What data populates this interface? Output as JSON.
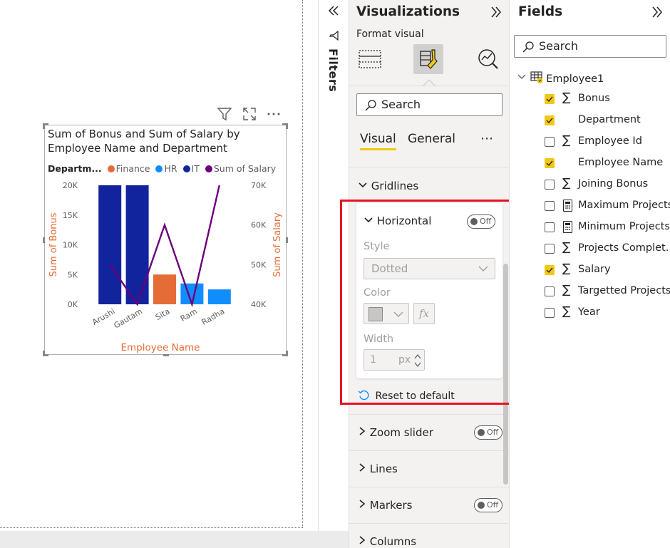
{
  "visual": {
    "title": "Sum of Bonus and Sum of Salary by Employee Name and Department",
    "legend": {
      "title": "Departm...",
      "items": [
        {
          "label": "Finance",
          "color": "#e66c37"
        },
        {
          "label": "HR",
          "color": "#118dff"
        },
        {
          "label": "IT",
          "color": "#12239e"
        },
        {
          "label": "Sum of Salary",
          "color": "#6b007b"
        }
      ]
    }
  },
  "chart_data": {
    "type": "bar",
    "title": "Sum of Bonus and Sum of Salary by Employee Name and Department",
    "xlabel": "Employee Name",
    "ylabel": "Sum of Bonus",
    "y2label": "Sum of Salary",
    "categories": [
      "Arushi",
      "Gautam",
      "Sita",
      "Ram",
      "Radha"
    ],
    "y_ticks": [
      "0K",
      "5K",
      "10K",
      "15K",
      "20K"
    ],
    "y2_ticks": [
      "40K",
      "50K",
      "60K",
      "70K"
    ],
    "ylim": [
      0,
      20000
    ],
    "y2lim": [
      40000,
      70000
    ],
    "series": [
      {
        "name": "IT",
        "color": "#12239e",
        "type": "bar",
        "values": [
          20000,
          20000,
          null,
          null,
          null
        ]
      },
      {
        "name": "Finance",
        "color": "#e66c37",
        "type": "bar",
        "values": [
          null,
          null,
          5000,
          null,
          null
        ]
      },
      {
        "name": "HR",
        "color": "#118dff",
        "type": "bar",
        "values": [
          null,
          null,
          null,
          3500,
          2500
        ]
      },
      {
        "name": "Sum of Salary",
        "color": "#6b007b",
        "type": "line",
        "axis": "secondary",
        "values": [
          50000,
          40000,
          60000,
          40000,
          70000
        ]
      }
    ],
    "grid": false,
    "legend_position": "top-left"
  },
  "filters": {
    "label": "Filters"
  },
  "viz_pane": {
    "title": "Visualizations",
    "format_visual": "Format visual",
    "search_placeholder": "Search",
    "tabs": [
      {
        "label": "Visual"
      },
      {
        "label": "General"
      }
    ],
    "more": "⋯",
    "gridlines": "Gridlines",
    "horizontal": {
      "label": "Horizontal",
      "toggle": "Off",
      "style_label": "Style",
      "style_value": "Dotted",
      "color_label": "Color",
      "width_label": "Width",
      "width_value": "1",
      "width_unit": "px"
    },
    "reset": "Reset to default",
    "sections": [
      {
        "label": "Zoom slider",
        "toggle": "Off"
      },
      {
        "label": "Lines"
      },
      {
        "label": "Markers",
        "toggle": "Off"
      },
      {
        "label": "Columns"
      }
    ]
  },
  "fields_pane": {
    "title": "Fields",
    "search_placeholder": "Search",
    "table": "Employee1",
    "fields": [
      {
        "label": "Bonus",
        "checked": true,
        "icon": "sigma"
      },
      {
        "label": "Department",
        "checked": true,
        "icon": "none"
      },
      {
        "label": "Employee Id",
        "checked": false,
        "icon": "sigma"
      },
      {
        "label": "Employee Name",
        "checked": true,
        "icon": "none"
      },
      {
        "label": "Joining Bonus",
        "checked": false,
        "icon": "sigma"
      },
      {
        "label": "Maximum Projects",
        "checked": false,
        "icon": "calculator"
      },
      {
        "label": "Minimum Projects",
        "checked": false,
        "icon": "calculator"
      },
      {
        "label": "Projects Complet...",
        "checked": false,
        "icon": "sigma"
      },
      {
        "label": "Salary",
        "checked": true,
        "icon": "sigma"
      },
      {
        "label": "Targetted Projects",
        "checked": false,
        "icon": "sigma"
      },
      {
        "label": "Year",
        "checked": false,
        "icon": "sigma"
      }
    ]
  }
}
